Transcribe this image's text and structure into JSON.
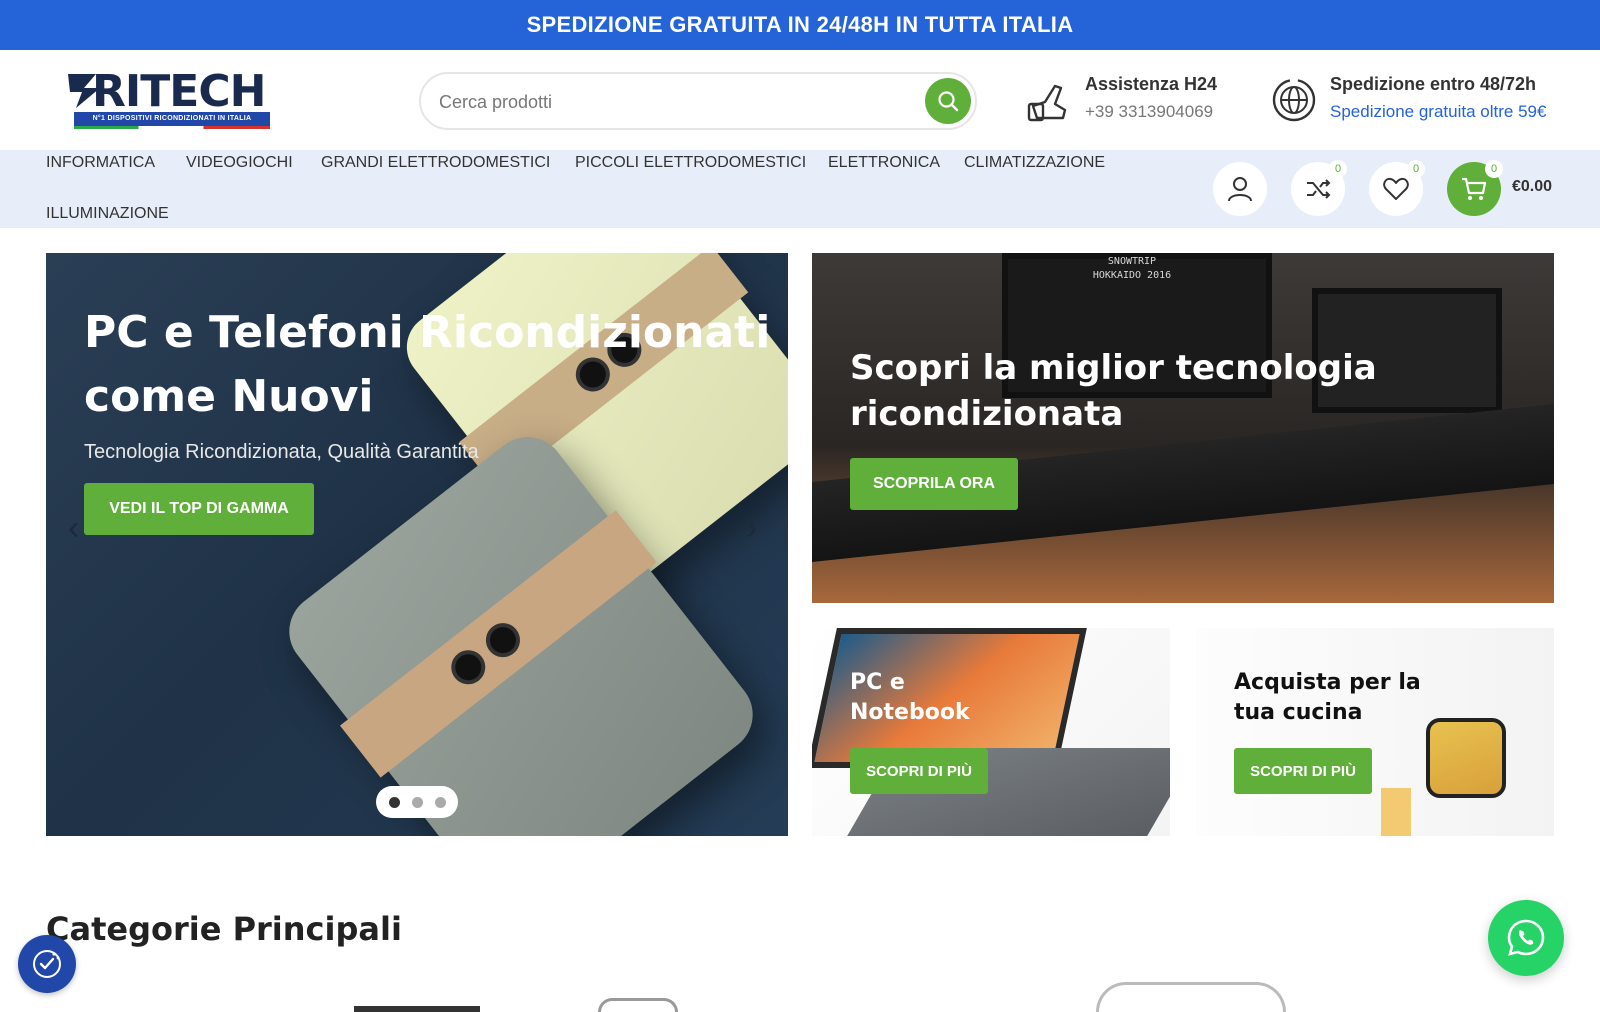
{
  "topbar": {
    "text": "SPEDIZIONE GRATUITA IN 24/48H IN TUTTA ITALIA"
  },
  "logo": {
    "name": "RITECH",
    "tagline": "N°1 DISPOSITIVI RICONDIZIONATI IN ITALIA"
  },
  "search": {
    "placeholder": "Cerca prodotti",
    "icon": "search-icon"
  },
  "assist": {
    "title": "Assistenza H24",
    "phone": "+39 3313904069",
    "icon": "phone-icon"
  },
  "ship": {
    "title": "Spedizione entro 48/72h",
    "subtitle": "Spedizione gratuita oltre 59€",
    "icon": "globe-icon"
  },
  "nav": {
    "items": [
      "INFORMATICA",
      "VIDEOGIOCHI",
      "GRANDI ELETTRODOMESTICI",
      "PICCOLI ELETTRODOMESTICI",
      "ELETTRONICA",
      "CLIMATIZZAZIONE",
      "ILLUMINAZIONE"
    ],
    "compare_count": "0",
    "wishlist_count": "0",
    "cart_count": "0",
    "cart_total": "€0.00"
  },
  "hero": {
    "title": "PC e Telefoni Ricondizionati come Nuovi",
    "subtitle": "Tecnologia Ricondizionata, Qualità Garantita",
    "button": "VEDI IL TOP DI GAMMA",
    "slides": 3,
    "active_slide": 1
  },
  "banner_tech": {
    "title": "Scopri la miglior tecnologia ricondizionata",
    "button": "SCOPRILA ORA",
    "monitor_text": "SNOWTRIP HOKKAIDO 2016"
  },
  "banner_pc": {
    "title": "PC e Notebook",
    "button": "SCOPRI DI PIÙ"
  },
  "banner_kitchen": {
    "title": "Acquista per la tua cucina",
    "button": "SCOPRI DI PIÙ"
  },
  "categories": {
    "title": "Categorie Principali"
  },
  "colors": {
    "primary_blue": "#2563d9",
    "accent_green": "#5faf3a",
    "nav_bg": "#e8eef9",
    "whatsapp": "#25d366"
  }
}
